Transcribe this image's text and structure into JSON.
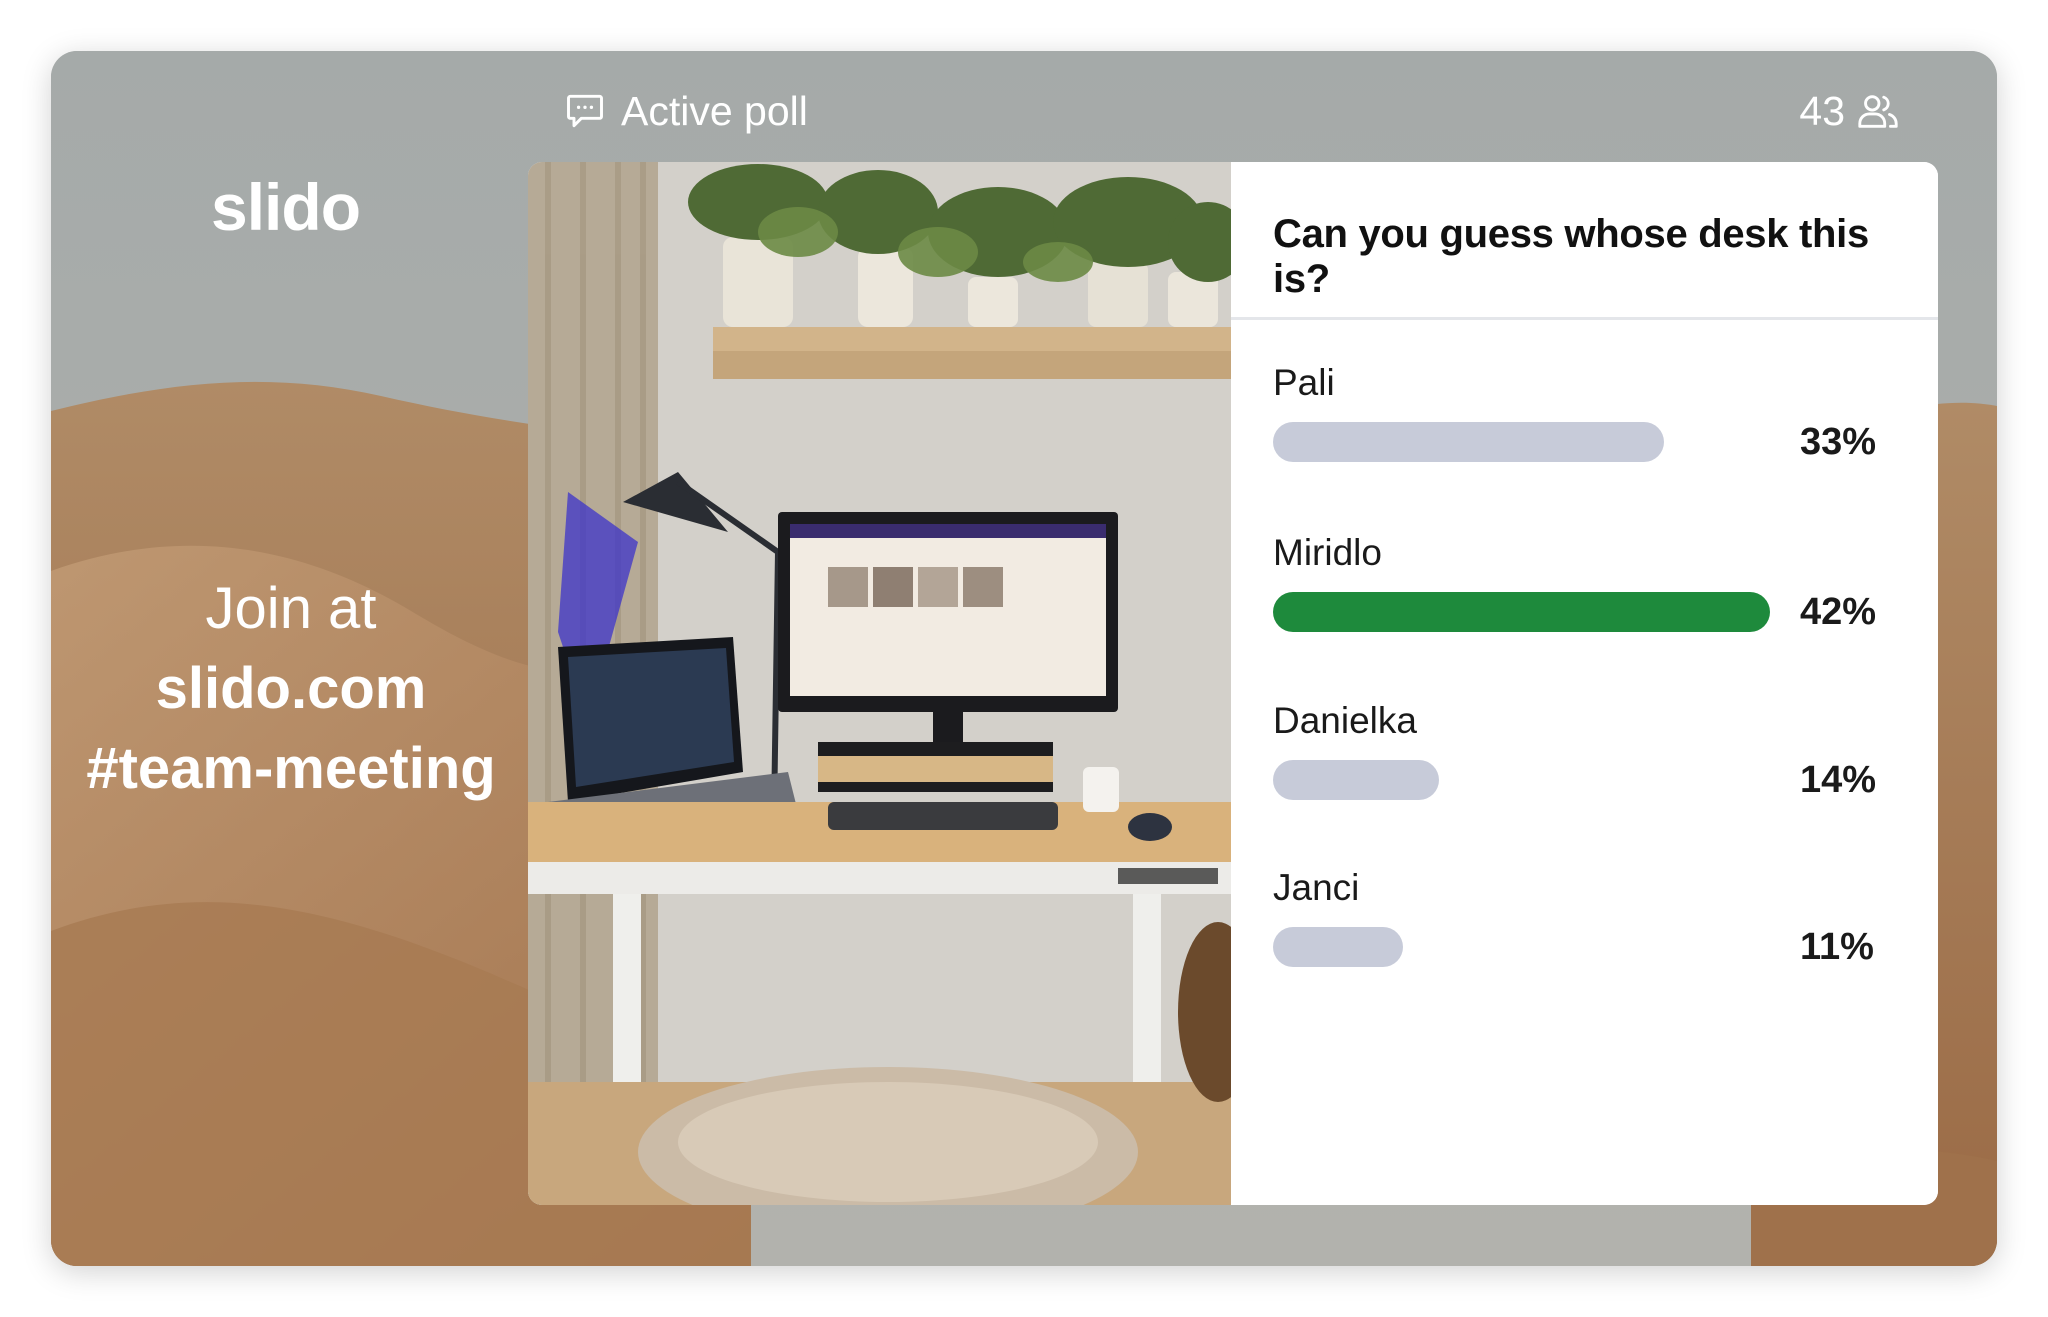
{
  "header": {
    "title": "Active poll",
    "participants_count": "43"
  },
  "logo": {
    "text": "slido"
  },
  "join": {
    "label": "Join at",
    "url": "slido.com",
    "code": "#team-meeting"
  },
  "poll": {
    "question": "Can you guess whose desk this is?",
    "options": [
      {
        "label": "Pali",
        "percent": "33%",
        "value": 33,
        "leading": false
      },
      {
        "label": "Miridlo",
        "percent": "42%",
        "value": 42,
        "leading": true
      },
      {
        "label": "Danielka",
        "percent": "14%",
        "value": 14,
        "leading": false
      },
      {
        "label": "Janci",
        "percent": "11%",
        "value": 11,
        "leading": false
      }
    ]
  },
  "colors": {
    "leading_bar": "#1e8a3c",
    "other_bar": "#c7cbd9"
  },
  "icons": {
    "title": "chat-bubble-icon",
    "participants": "people-icon"
  },
  "photo": {
    "description_icon": "desk-photo"
  }
}
